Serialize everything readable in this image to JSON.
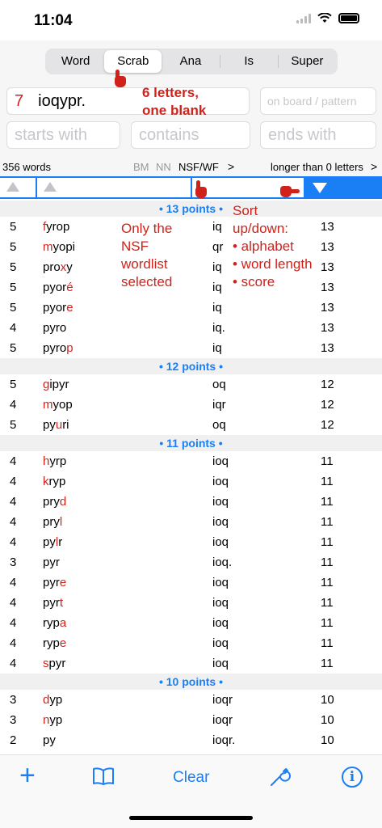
{
  "status": {
    "time": "11:04"
  },
  "tabs": [
    {
      "label": "Word",
      "active": false
    },
    {
      "label": "Scrab",
      "active": true
    },
    {
      "label": "Ana",
      "active": false
    },
    {
      "label": "Is",
      "active": false
    },
    {
      "label": "Super",
      "active": false
    }
  ],
  "letters_field": {
    "count": "7",
    "value": "ioqypr."
  },
  "board_field": {
    "placeholder": "on board / pattern"
  },
  "starts_field": {
    "placeholder": "starts with"
  },
  "contains_field": {
    "placeholder": "contains"
  },
  "ends_field": {
    "placeholder": "ends with"
  },
  "info": {
    "word_count": "356 words",
    "bm": "BM",
    "nn": "NN",
    "nsf": "NSF/WF",
    "chevron": ">",
    "longer": "longer than 0 letters"
  },
  "annotations": {
    "blank": [
      "6 letters,",
      "one blank"
    ],
    "nsf": [
      "Only the",
      "NSF",
      "wordlist",
      "selected"
    ],
    "sort": [
      "Sort",
      "up/down:",
      "• alphabet",
      "• word length",
      "• score"
    ]
  },
  "sections": [
    {
      "header": "• 13 points •",
      "rows": [
        {
          "len": "5",
          "pre": "",
          "red": "f",
          "post": "yrop",
          "letters": "iq",
          "score": "13"
        },
        {
          "len": "5",
          "pre": "",
          "red": "m",
          "post": "yopi",
          "letters": "qr",
          "score": "13"
        },
        {
          "len": "5",
          "pre": "pro",
          "red": "x",
          "post": "y",
          "letters": "iq",
          "score": "13"
        },
        {
          "len": "5",
          "pre": "pyor",
          "red": "é",
          "post": "",
          "letters": "iq",
          "score": "13"
        },
        {
          "len": "5",
          "pre": "pyor",
          "red": "e",
          "post": "",
          "letters": "iq",
          "score": "13"
        },
        {
          "len": "4",
          "pre": "pyro",
          "red": "",
          "post": "",
          "letters": "iq.",
          "score": "13"
        },
        {
          "len": "5",
          "pre": "pyro",
          "red": "p",
          "post": "",
          "letters": "iq",
          "score": "13"
        }
      ]
    },
    {
      "header": "• 12 points •",
      "rows": [
        {
          "len": "5",
          "pre": "",
          "red": "g",
          "post": "ipyr",
          "letters": "oq",
          "score": "12"
        },
        {
          "len": "4",
          "pre": "",
          "red": "m",
          "post": "yop",
          "letters": "iqr",
          "score": "12"
        },
        {
          "len": "5",
          "pre": "py",
          "red": "u",
          "post": "ri",
          "letters": "oq",
          "score": "12"
        }
      ]
    },
    {
      "header": "• 11 points •",
      "rows": [
        {
          "len": "4",
          "pre": "",
          "red": "h",
          "post": "yrp",
          "letters": "ioq",
          "score": "11"
        },
        {
          "len": "4",
          "pre": "",
          "red": "k",
          "post": "ryp",
          "letters": "ioq",
          "score": "11"
        },
        {
          "len": "4",
          "pre": "pry",
          "red": "d",
          "post": "",
          "letters": "ioq",
          "score": "11"
        },
        {
          "len": "4",
          "pre": "pry",
          "red": "l",
          "post": "",
          "letters": "ioq",
          "score": "11"
        },
        {
          "len": "4",
          "pre": "py",
          "red": "l",
          "post": "r",
          "letters": "ioq",
          "score": "11"
        },
        {
          "len": "3",
          "pre": "pyr",
          "red": "",
          "post": "",
          "letters": "ioq.",
          "score": "11"
        },
        {
          "len": "4",
          "pre": "pyr",
          "red": "e",
          "post": "",
          "letters": "ioq",
          "score": "11"
        },
        {
          "len": "4",
          "pre": "pyr",
          "red": "t",
          "post": "",
          "letters": "ioq",
          "score": "11"
        },
        {
          "len": "4",
          "pre": "ryp",
          "red": "a",
          "post": "",
          "letters": "ioq",
          "score": "11"
        },
        {
          "len": "4",
          "pre": "ryp",
          "red": "e",
          "post": "",
          "letters": "ioq",
          "score": "11"
        },
        {
          "len": "4",
          "pre": "",
          "red": "s",
          "post": "pyr",
          "letters": "ioq",
          "score": "11"
        }
      ]
    },
    {
      "header": "• 10 points •",
      "rows": [
        {
          "len": "3",
          "pre": "",
          "red": "d",
          "post": "yp",
          "letters": "ioqr",
          "score": "10"
        },
        {
          "len": "3",
          "pre": "",
          "red": "n",
          "post": "yp",
          "letters": "ioqr",
          "score": "10"
        },
        {
          "len": "2",
          "pre": "py",
          "red": "",
          "post": "",
          "letters": "ioqr.",
          "score": "10"
        }
      ]
    }
  ],
  "toolbar": {
    "clear": "Clear",
    "info": "i"
  },
  "colors": {
    "accent": "#1a7ff5",
    "highlight": "#d0221b"
  }
}
